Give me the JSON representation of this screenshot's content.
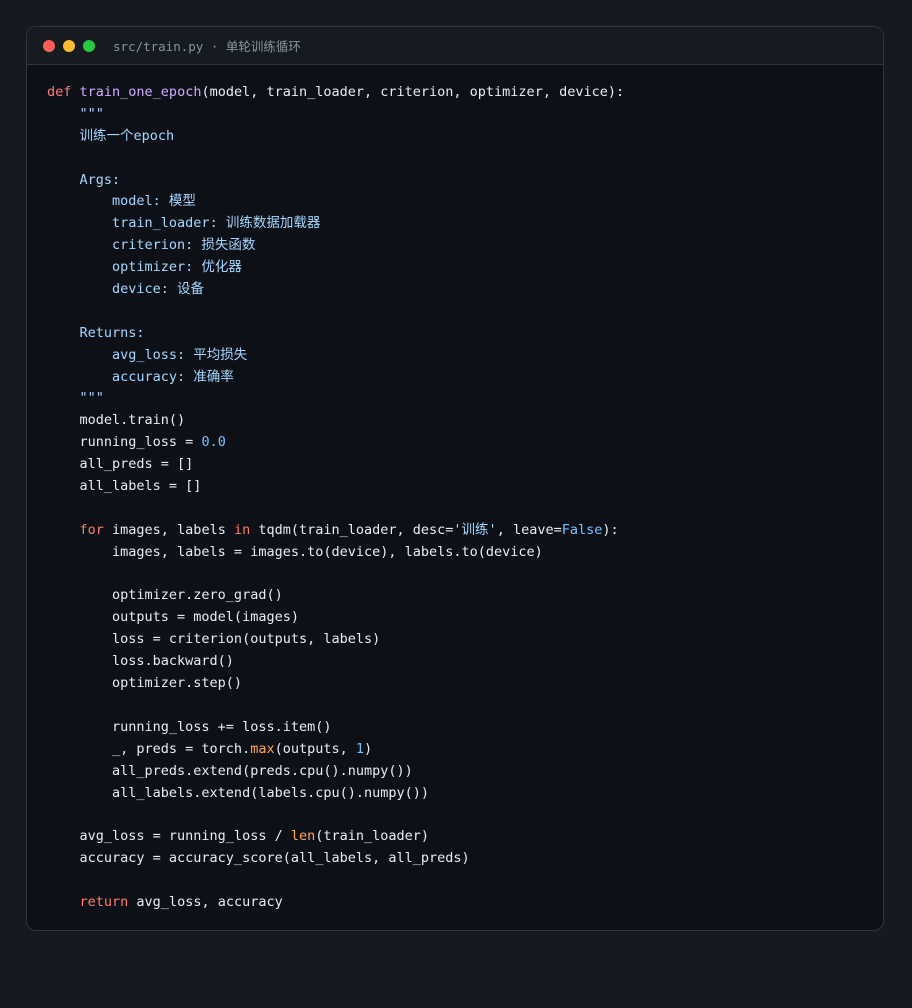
{
  "window": {
    "title": "src/train.py · 单轮训练循环",
    "traffic_lights": {
      "close_color": "#ff5f57",
      "minimize_color": "#febc2e",
      "maximize_color": "#28c840"
    }
  },
  "code": {
    "language": "python",
    "lines": [
      [
        {
          "t": "def",
          "c": "kw"
        },
        {
          "t": " "
        },
        {
          "t": "train_one_epoch",
          "c": "fn"
        },
        {
          "t": "(model, train_loader, criterion, optimizer, device):"
        }
      ],
      [
        {
          "t": "    \"\"\"",
          "c": "cmt"
        }
      ],
      [
        {
          "t": "    训练一个epoch",
          "c": "cmt"
        }
      ],
      [
        {
          "t": ""
        }
      ],
      [
        {
          "t": "    Args:",
          "c": "sec"
        }
      ],
      [
        {
          "t": "        model",
          "c": "par"
        },
        {
          "t": ": 模型",
          "c": "cmt"
        }
      ],
      [
        {
          "t": "        train_loader",
          "c": "par"
        },
        {
          "t": ": 训练数据加载器",
          "c": "cmt"
        }
      ],
      [
        {
          "t": "        criterion",
          "c": "par"
        },
        {
          "t": ": 损失函数",
          "c": "cmt"
        }
      ],
      [
        {
          "t": "        optimizer",
          "c": "par"
        },
        {
          "t": ": 优化器",
          "c": "cmt"
        }
      ],
      [
        {
          "t": "        device",
          "c": "par"
        },
        {
          "t": ": 设备",
          "c": "cmt"
        }
      ],
      [
        {
          "t": ""
        }
      ],
      [
        {
          "t": "    Returns:",
          "c": "sec"
        }
      ],
      [
        {
          "t": "        avg_loss",
          "c": "par"
        },
        {
          "t": ": 平均损失",
          "c": "cmt"
        }
      ],
      [
        {
          "t": "        accuracy",
          "c": "par"
        },
        {
          "t": ": 准确率",
          "c": "cmt"
        }
      ],
      [
        {
          "t": "    \"\"\"",
          "c": "cmt"
        }
      ],
      [
        {
          "t": "    model.train()"
        }
      ],
      [
        {
          "t": "    running_loss = "
        },
        {
          "t": "0.0",
          "c": "num"
        }
      ],
      [
        {
          "t": "    all_preds = []"
        }
      ],
      [
        {
          "t": "    all_labels = []"
        }
      ],
      [
        {
          "t": ""
        }
      ],
      [
        {
          "t": "    "
        },
        {
          "t": "for",
          "c": "kw"
        },
        {
          "t": " images, labels "
        },
        {
          "t": "in",
          "c": "kw"
        },
        {
          "t": " tqdm(train_loader, desc="
        },
        {
          "t": "'训练'",
          "c": "str"
        },
        {
          "t": ", leave="
        },
        {
          "t": "False",
          "c": "con"
        },
        {
          "t": "):"
        }
      ],
      [
        {
          "t": "        images, labels = images.to(device), labels.to(device)"
        }
      ],
      [
        {
          "t": ""
        }
      ],
      [
        {
          "t": "        optimizer.zero_grad()"
        }
      ],
      [
        {
          "t": "        outputs = model(images)"
        }
      ],
      [
        {
          "t": "        loss = criterion(outputs, labels)"
        }
      ],
      [
        {
          "t": "        loss.backward()"
        }
      ],
      [
        {
          "t": "        optimizer.step()"
        }
      ],
      [
        {
          "t": ""
        }
      ],
      [
        {
          "t": "        running_loss += loss.item()"
        }
      ],
      [
        {
          "t": "        _, preds = torch."
        },
        {
          "t": "max",
          "c": "bi"
        },
        {
          "t": "(outputs, "
        },
        {
          "t": "1",
          "c": "num"
        },
        {
          "t": ")"
        }
      ],
      [
        {
          "t": "        all_preds.extend(preds.cpu().numpy())"
        }
      ],
      [
        {
          "t": "        all_labels.extend(labels.cpu().numpy())"
        }
      ],
      [
        {
          "t": ""
        }
      ],
      [
        {
          "t": "    avg_loss = running_loss / "
        },
        {
          "t": "len",
          "c": "bi"
        },
        {
          "t": "(train_loader)"
        }
      ],
      [
        {
          "t": "    accuracy = accuracy_score(all_labels, all_preds)"
        }
      ],
      [
        {
          "t": ""
        }
      ],
      [
        {
          "t": "    "
        },
        {
          "t": "return",
          "c": "kw"
        },
        {
          "t": " avg_loss, accuracy"
        }
      ]
    ]
  }
}
